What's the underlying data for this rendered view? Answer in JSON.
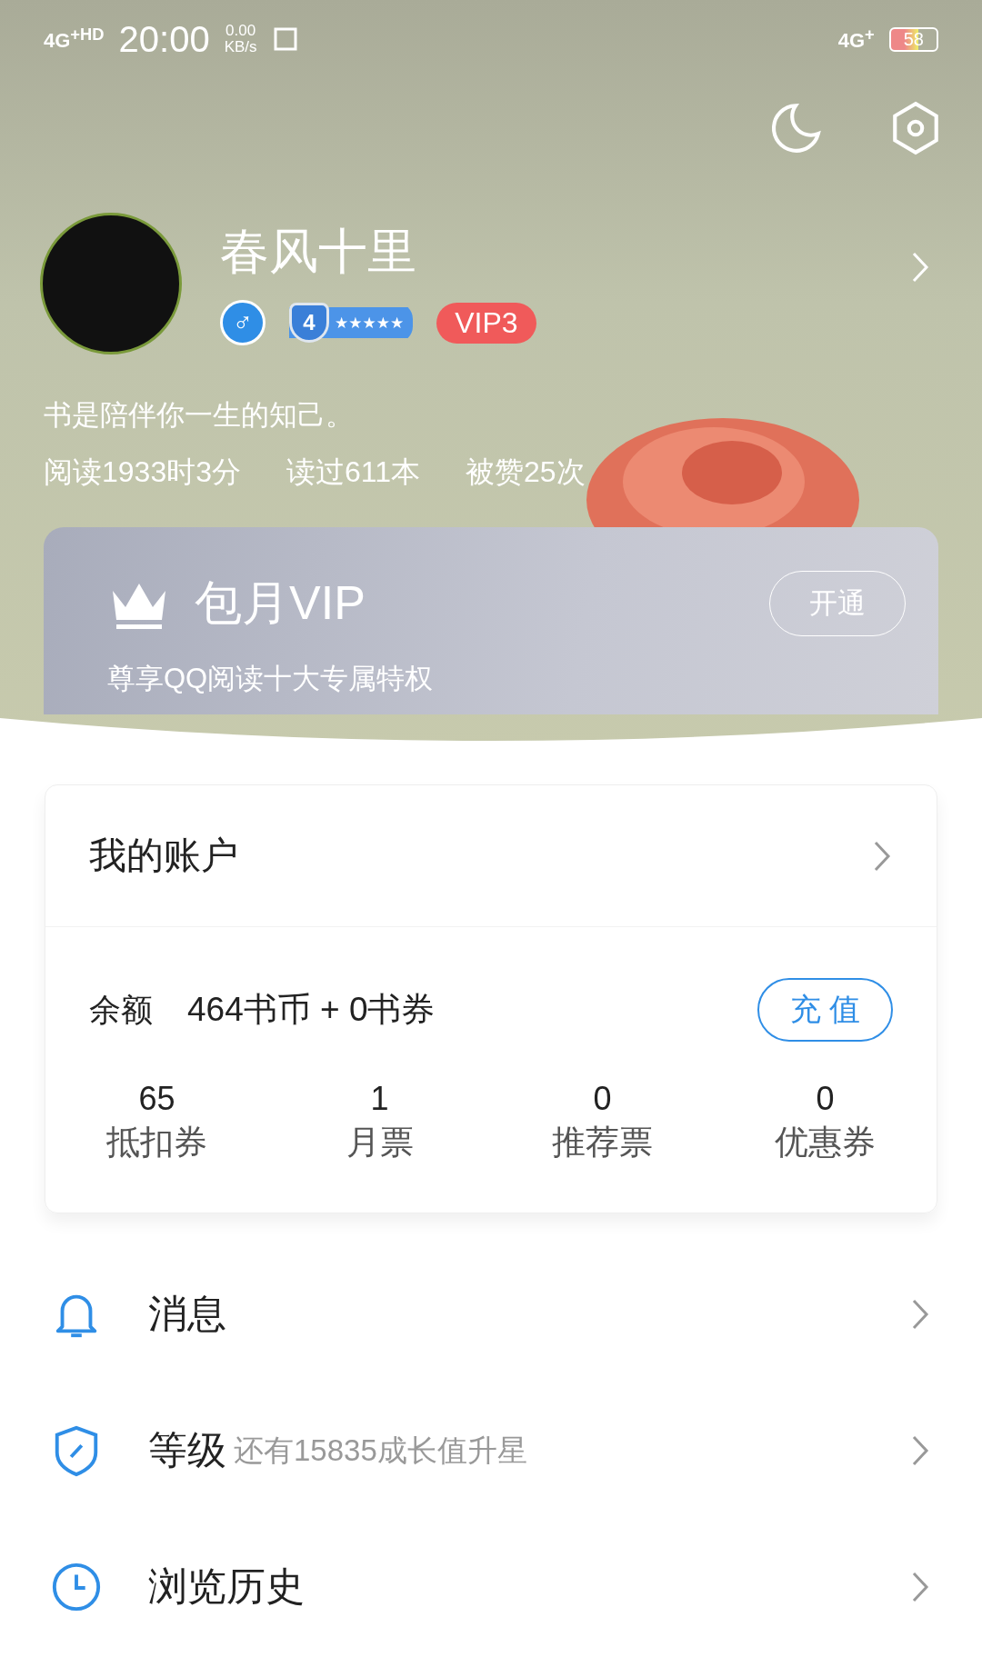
{
  "status_bar": {
    "network_left": "4G$^{+HD}$",
    "time": "20:00",
    "speed": "0.00",
    "speed_unit": "KB/s",
    "network_right": "4G$^{+}$",
    "battery": "58"
  },
  "profile": {
    "name": "春风十里",
    "gender": "♂",
    "rank": "4",
    "stars": 5,
    "vip": "VIP3",
    "motto": "书是陪伴你一生的知己。",
    "stats": [
      "阅读1933时3分",
      "读过611本",
      "被赞25次"
    ]
  },
  "vip_card": {
    "title": "包月VIP",
    "subtitle": "尊享QQ阅读十大专属特权",
    "button": "开通"
  },
  "account": {
    "title": "我的账户",
    "balance_label": "余额",
    "balance_value": "464书币 + 0书券",
    "recharge": "充 值",
    "counts": [
      {
        "value": "65",
        "label": "抵扣券"
      },
      {
        "value": "1",
        "label": "月票"
      },
      {
        "value": "0",
        "label": "推荐票"
      },
      {
        "value": "0",
        "label": "优惠券"
      }
    ]
  },
  "menu": [
    {
      "kind": "bell",
      "label": "消息"
    },
    {
      "kind": "shield",
      "label": "等级",
      "hint": "还有15835成长值升星"
    },
    {
      "kind": "clock",
      "label": "浏览历史"
    }
  ]
}
